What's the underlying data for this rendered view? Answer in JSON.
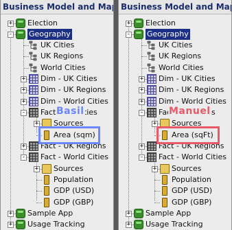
{
  "left": {
    "title": "Business Model and Mapping",
    "callout_label": "Basil",
    "callout_color": "#6b86ff",
    "items": {
      "election": "Election",
      "geography": "Geography",
      "uk_cities": "UK Cities",
      "uk_regions": "UK Regions",
      "world_cities": "World Cities",
      "dim_uk_cities": "Dim - UK Cities",
      "dim_uk_regions": "Dim - UK Regions",
      "dim_world_cities": "Dim - World Cities",
      "fact_uk_cities": "Fact - UK Cities",
      "sources_1": "Sources",
      "area": "Area (sqm)",
      "fact_uk_regions": "Fact - UK Regions",
      "fact_world_cities": "Fact - World Cities",
      "sources_2": "Sources",
      "population": "Population",
      "gdp_usd": "GDP (USD)",
      "gdp_gbp": "GDP (GBP)",
      "sample_app": "Sample App",
      "usage_tracking": "Usage Tracking"
    }
  },
  "right": {
    "title": "Business Model and Mapping",
    "callout_label": "Manuel",
    "callout_color": "#e85a68",
    "items": {
      "election": "Election",
      "geography": "Geography",
      "uk_cities": "UK Cities",
      "uk_regions": "UK Regions",
      "world_cities": "World Cities",
      "dim_uk_cities": "Dim - UK Cities",
      "dim_uk_regions": "Dim - UK Regions",
      "dim_world_cities": "Dim - World Cities",
      "fact_uk_cities": "Fact - UK Cities",
      "sources_1": "Sources",
      "area": "Area (sqFt)",
      "fact_uk_regions": "Fact - UK Regions",
      "fact_world_cities": "Fact - World Cities",
      "sources_2": "Sources",
      "population": "Population",
      "gdp_usd": "GDP (USD)",
      "gdp_gbp": "GDP (GBP)",
      "sample_app": "Sample App",
      "usage_tracking": "Usage Tracking"
    }
  }
}
